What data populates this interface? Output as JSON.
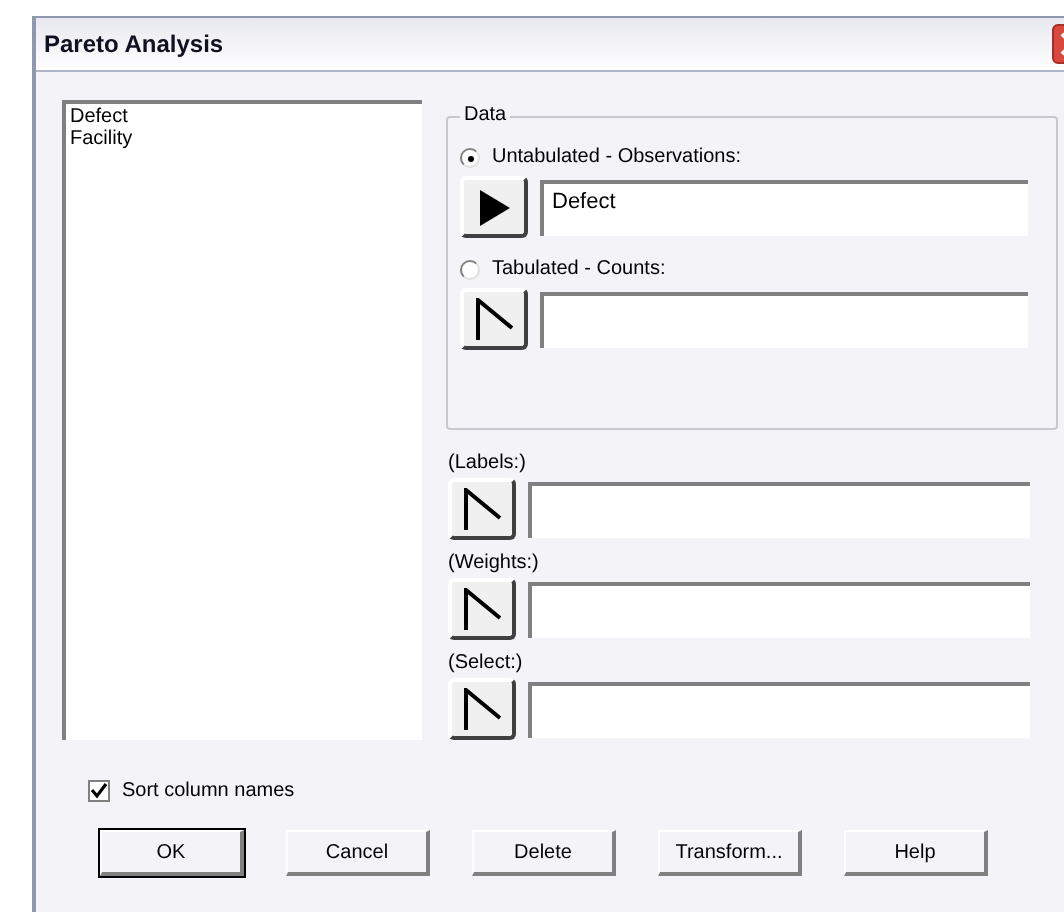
{
  "window": {
    "title": "Pareto Analysis"
  },
  "columns": [
    {
      "label": "Defect"
    },
    {
      "label": "Facility"
    }
  ],
  "data_group": {
    "title": "Data",
    "options": [
      {
        "label": "Untabulated - Observations:",
        "selected": true,
        "value": "Defect",
        "active": true
      },
      {
        "label": "Tabulated - Counts:",
        "selected": false,
        "active": false
      }
    ]
  },
  "inputs": [
    {
      "label": "(Labels:)",
      "active": false
    },
    {
      "label": "(Weights:)",
      "active": false
    },
    {
      "label": "(Select:)",
      "active": false
    }
  ],
  "sort_column_names": {
    "label": "Sort column names",
    "checked": true
  },
  "buttons": [
    {
      "label": "OK",
      "default": true
    },
    {
      "label": "Cancel",
      "default": false
    },
    {
      "label": "Delete",
      "default": false
    },
    {
      "label": "Transform...",
      "default": false
    },
    {
      "label": "Help",
      "default": false
    }
  ]
}
